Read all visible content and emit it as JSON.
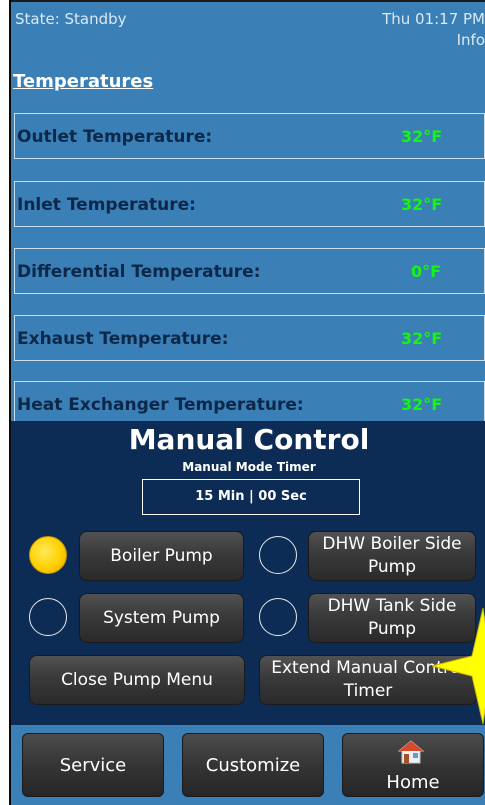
{
  "status": {
    "state": "State: Standby",
    "clock": "Thu 01:17 PM",
    "info": "Info"
  },
  "temperatures": {
    "title": "Temperatures",
    "rows": [
      {
        "label": "Outlet Temperature:",
        "value": "32°F"
      },
      {
        "label": "Inlet Temperature:",
        "value": "32°F"
      },
      {
        "label": "Differential Temperature:",
        "value": "0°F"
      },
      {
        "label": "Exhaust Temperature:",
        "value": "32°F"
      },
      {
        "label": "Heat Exchanger Temperature:",
        "value": "32°F"
      }
    ]
  },
  "manual": {
    "title": "Manual Control",
    "timer_label": "Manual Mode Timer",
    "timer_value": "15 Min | 00 Sec",
    "pumps": [
      {
        "label": "Boiler Pump",
        "on": true
      },
      {
        "label": "DHW Boiler Side Pump",
        "on": false
      },
      {
        "label": "System Pump",
        "on": false
      },
      {
        "label": "DHW Tank Side Pump",
        "on": false
      }
    ],
    "close_label": "Close Pump Menu",
    "extend_label": "Extend Manual Control Timer"
  },
  "footer": {
    "service": "Service",
    "customize": "Customize",
    "home": "Home"
  },
  "colors": {
    "background": "#3a7fb6",
    "panel": "#0c2c55",
    "value_green": "#15f415",
    "led_on": "#ffd000",
    "highlight_star": "#ffff00"
  },
  "icons": {
    "home": "home-icon",
    "highlight": "star-marker"
  }
}
